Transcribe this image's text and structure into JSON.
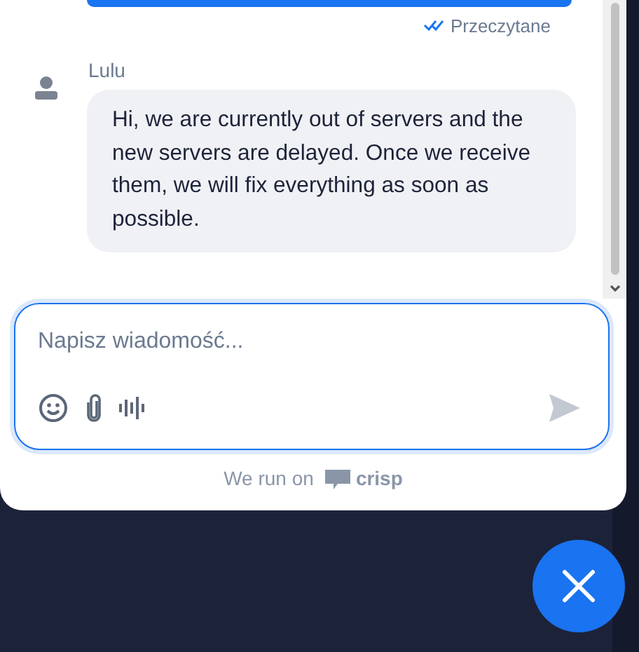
{
  "read_receipt": {
    "label": "Przeczytane",
    "read": true
  },
  "messages": [
    {
      "sender": "Lulu",
      "text": "Hi, we are currently out of servers and the new servers are delayed. Once we receive them, we will fix everything as soon as possible."
    }
  ],
  "composer": {
    "placeholder": "Napisz wiadomość...",
    "focused": true
  },
  "footer": {
    "label": "We run on",
    "brand": "crisp"
  }
}
